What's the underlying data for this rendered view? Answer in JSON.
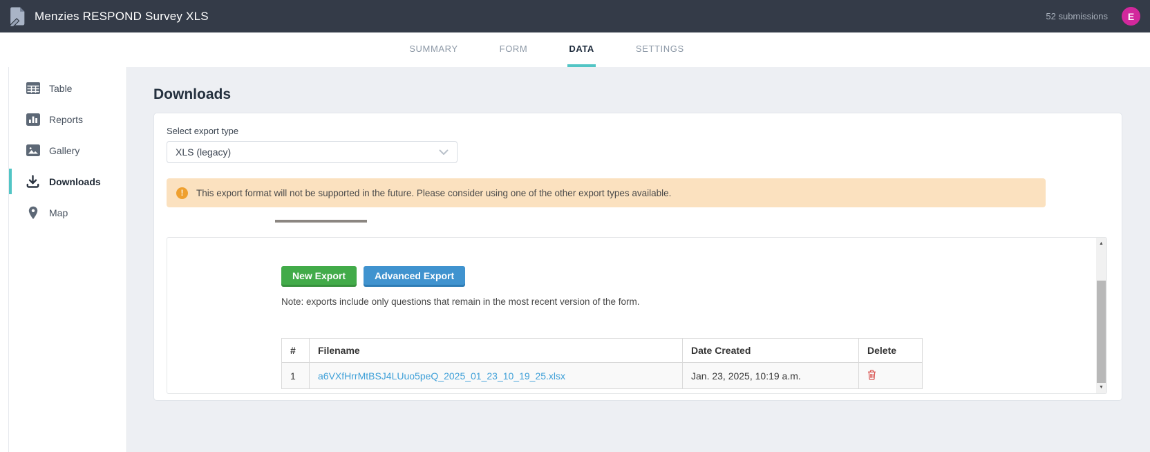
{
  "header": {
    "title": "Menzies RESPOND Survey XLS",
    "submissions_count": "52 submissions",
    "avatar_initial": "E"
  },
  "tabs": [
    {
      "label": "SUMMARY",
      "active": false
    },
    {
      "label": "FORM",
      "active": false
    },
    {
      "label": "DATA",
      "active": true
    },
    {
      "label": "SETTINGS",
      "active": false
    }
  ],
  "sidebar": {
    "items": [
      {
        "label": "Table",
        "icon": "table-icon",
        "active": false
      },
      {
        "label": "Reports",
        "icon": "reports-icon",
        "active": false
      },
      {
        "label": "Gallery",
        "icon": "gallery-icon",
        "active": false
      },
      {
        "label": "Downloads",
        "icon": "download-icon",
        "active": true
      },
      {
        "label": "Map",
        "icon": "map-pin-icon",
        "active": false
      }
    ]
  },
  "main": {
    "page_title": "Downloads",
    "export_type": {
      "label": "Select export type",
      "selected": "XLS (legacy)",
      "icon": "chevron-down-icon"
    },
    "warning": {
      "icon": "exclamation-circle-icon",
      "text": "This export format will not be supported in the future. Please consider using one of the other export types available."
    },
    "exports": {
      "new_export_label": "New Export",
      "advanced_export_label": "Advanced Export",
      "note": "Note: exports include only questions that remain in the most recent version of the form.",
      "table": {
        "headers": [
          "#",
          "Filename",
          "Date Created",
          "Delete"
        ],
        "rows": [
          {
            "num": "1",
            "filename": "a6VXfHrrMtBSJ4LUuo5peQ_2025_01_23_10_19_25.xlsx",
            "date_created": "Jan. 23, 2025, 10:19 a.m.",
            "delete_icon": "trash-icon"
          }
        ]
      }
    }
  },
  "colors": {
    "header_bg": "#343b48",
    "accent_teal": "#52c5c5",
    "avatar_magenta": "#d2289c",
    "warning_bg": "#fbe1bf",
    "warning_icon_orange": "#efa02f",
    "green_button": "#42ab49",
    "blue_button": "#4093cf",
    "link_blue": "#3fa0d8",
    "delete_red": "#d9534f"
  }
}
